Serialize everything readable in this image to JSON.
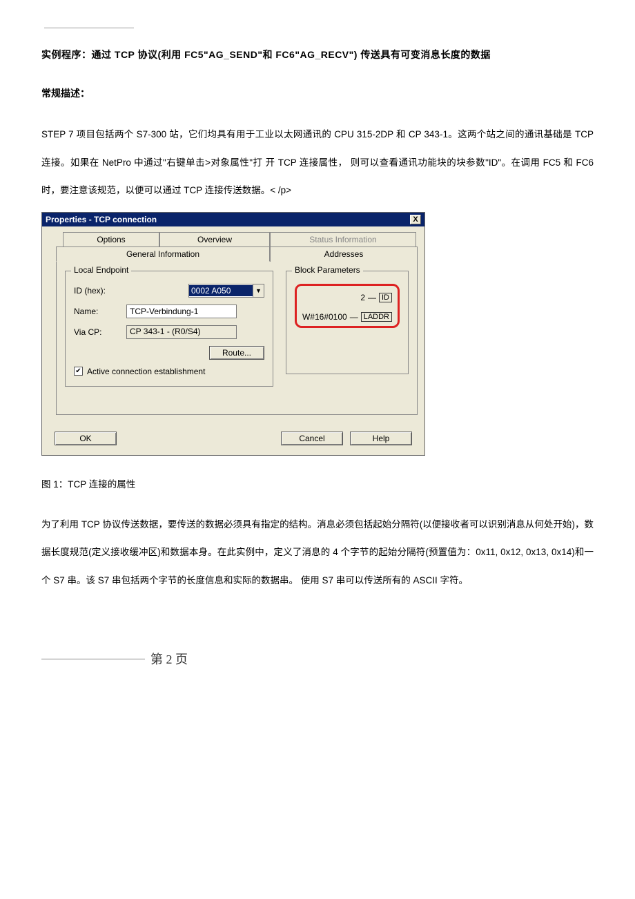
{
  "title": "实例程序：通过 TCP 协议(利用 FC5\"AG_SEND\"和 FC6\"AG_RECV\")  传送具有可变消息长度的数据",
  "section_heading": "常规描述：",
  "para1": "STEP 7 项目包括两个 S7-300 站，它们均具有用于工业以太网通讯的 CPU 315-2DP 和 CP 343-1。这两个站之间的通讯基础是 TCP 连接。如果在 NetPro 中通过\"右键单击>对象属性\"打  开 TCP 连接属性，  则可以查看通讯功能块的块参数\"ID\"。在调用 FC5 和 FC6 时，要注意该规范，以便可以通过 TCP 连接传送数据。< /p>",
  "dialog": {
    "title": "Properties - TCP connection",
    "close": "X",
    "tabs": {
      "options": "Options",
      "overview": "Overview",
      "status": "Status Information",
      "general": "General Information",
      "addresses": "Addresses"
    },
    "local_endpoint": {
      "legend": "Local Endpoint",
      "id_label": "ID (hex):",
      "id_value": "0002 A050",
      "name_label": "Name:",
      "name_value": "TCP-Verbindung-1",
      "via_label": "Via CP:",
      "via_value": "CP 343-1 - (R0/S4)",
      "route_btn": "Route...",
      "active_conn": "Active connection establishment"
    },
    "block_params": {
      "legend": "Block Parameters",
      "id_val": "2",
      "id_label": "ID",
      "laddr_val": "W#16#0100",
      "laddr_label": "LADDR"
    },
    "buttons": {
      "ok": "OK",
      "cancel": "Cancel",
      "help": "Help"
    }
  },
  "caption": "图 1：TCP 连接的属性",
  "para2": "为了利用 TCP 协议传送数据，要传送的数据必须具有指定的结构。消息必须包括起始分隔符(以便接收者可以识别消息从何处开始)，数  据长度规范(定义接收缓冲区)和数据本身。在此实例中，定义了消息的 4 个字节的起始分隔符(预置值为：0x11, 0x12, 0x13, 0x14)和一个 S7 串。该 S7 串包括两个字节的长度信息和实际的数据串。  使用 S7 串可以传送所有的 ASCII 字符。",
  "footer": "第  2  页"
}
